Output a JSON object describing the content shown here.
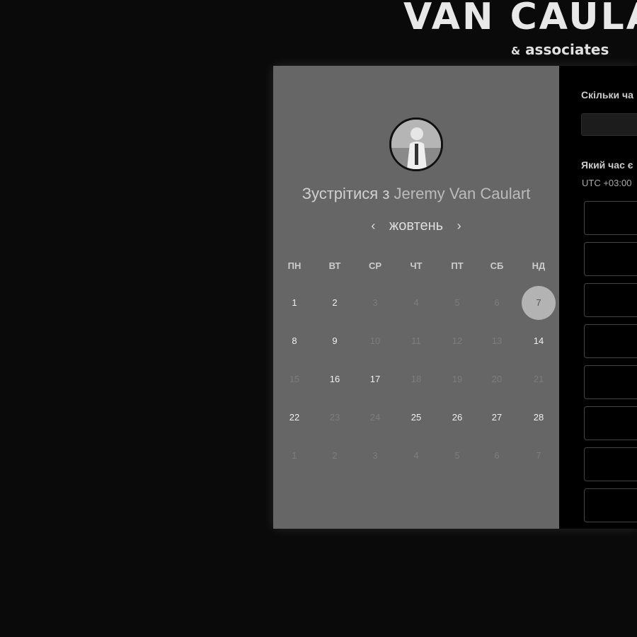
{
  "brand": {
    "title": "VAN CAULA",
    "amp": "&",
    "sub": "associates"
  },
  "profile": {
    "meet_prefix": "Зустрітися з",
    "name": "Jeremy Van Caulart"
  },
  "calendar": {
    "month": "жовтень",
    "prev_icon": "‹",
    "next_icon": "›",
    "weekdays": [
      "ПН",
      "ВТ",
      "СР",
      "ЧТ",
      "ПТ",
      "СБ",
      "НД"
    ],
    "weeks": [
      [
        {
          "d": "1",
          "s": "avail"
        },
        {
          "d": "2",
          "s": "avail"
        },
        {
          "d": "3",
          "s": "off"
        },
        {
          "d": "4",
          "s": "off"
        },
        {
          "d": "5",
          "s": "off"
        },
        {
          "d": "6",
          "s": "off"
        },
        {
          "d": "7",
          "s": "sel"
        }
      ],
      [
        {
          "d": "8",
          "s": "avail"
        },
        {
          "d": "9",
          "s": "avail"
        },
        {
          "d": "10",
          "s": "off"
        },
        {
          "d": "11",
          "s": "off"
        },
        {
          "d": "12",
          "s": "off"
        },
        {
          "d": "13",
          "s": "off"
        },
        {
          "d": "14",
          "s": "avail"
        }
      ],
      [
        {
          "d": "15",
          "s": "off"
        },
        {
          "d": "16",
          "s": "avail"
        },
        {
          "d": "17",
          "s": "avail"
        },
        {
          "d": "18",
          "s": "off"
        },
        {
          "d": "19",
          "s": "off"
        },
        {
          "d": "20",
          "s": "off"
        },
        {
          "d": "21",
          "s": "off"
        }
      ],
      [
        {
          "d": "22",
          "s": "avail"
        },
        {
          "d": "23",
          "s": "off"
        },
        {
          "d": "24",
          "s": "off"
        },
        {
          "d": "25",
          "s": "avail"
        },
        {
          "d": "26",
          "s": "avail"
        },
        {
          "d": "27",
          "s": "avail"
        },
        {
          "d": "28",
          "s": "avail"
        }
      ],
      [
        {
          "d": "1",
          "s": "off"
        },
        {
          "d": "2",
          "s": "off"
        },
        {
          "d": "3",
          "s": "off"
        },
        {
          "d": "4",
          "s": "off"
        },
        {
          "d": "5",
          "s": "off"
        },
        {
          "d": "6",
          "s": "off"
        },
        {
          "d": "7",
          "s": "off"
        }
      ]
    ]
  },
  "booking": {
    "duration_label": "Скільки ча",
    "time_label": "Який час є",
    "timezone": "UTC +03:00",
    "slot_count": 8
  }
}
